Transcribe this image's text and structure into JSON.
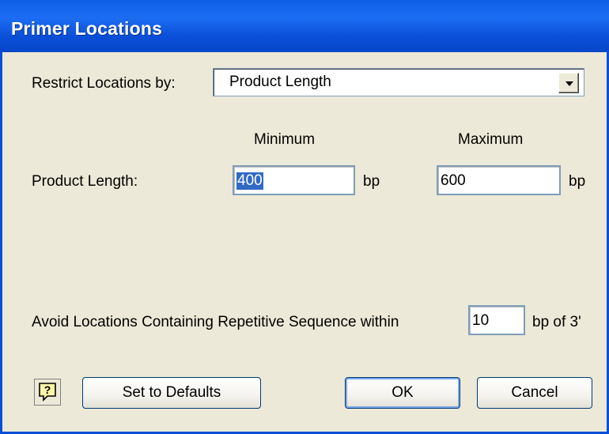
{
  "window": {
    "title": "Primer Locations"
  },
  "restrict": {
    "label": "Restrict Locations by:",
    "value": "Product Length"
  },
  "columns": {
    "minimum": "Minimum",
    "maximum": "Maximum"
  },
  "product_length": {
    "label": "Product Length:",
    "min_value": "400",
    "max_value": "600",
    "unit": "bp"
  },
  "avoid": {
    "label": "Avoid Locations Containing Repetitive Sequence within",
    "value": "10",
    "suffix": "bp of 3'"
  },
  "buttons": {
    "set_defaults": "Set to Defaults",
    "ok": "OK",
    "cancel": "Cancel"
  },
  "icons": {
    "help": "help-question-icon",
    "dropdown": "chevron-down-icon"
  },
  "colors": {
    "titlebar": "#0a4fd8",
    "dialog_bg": "#ece9d8",
    "selection": "#316ac5"
  }
}
